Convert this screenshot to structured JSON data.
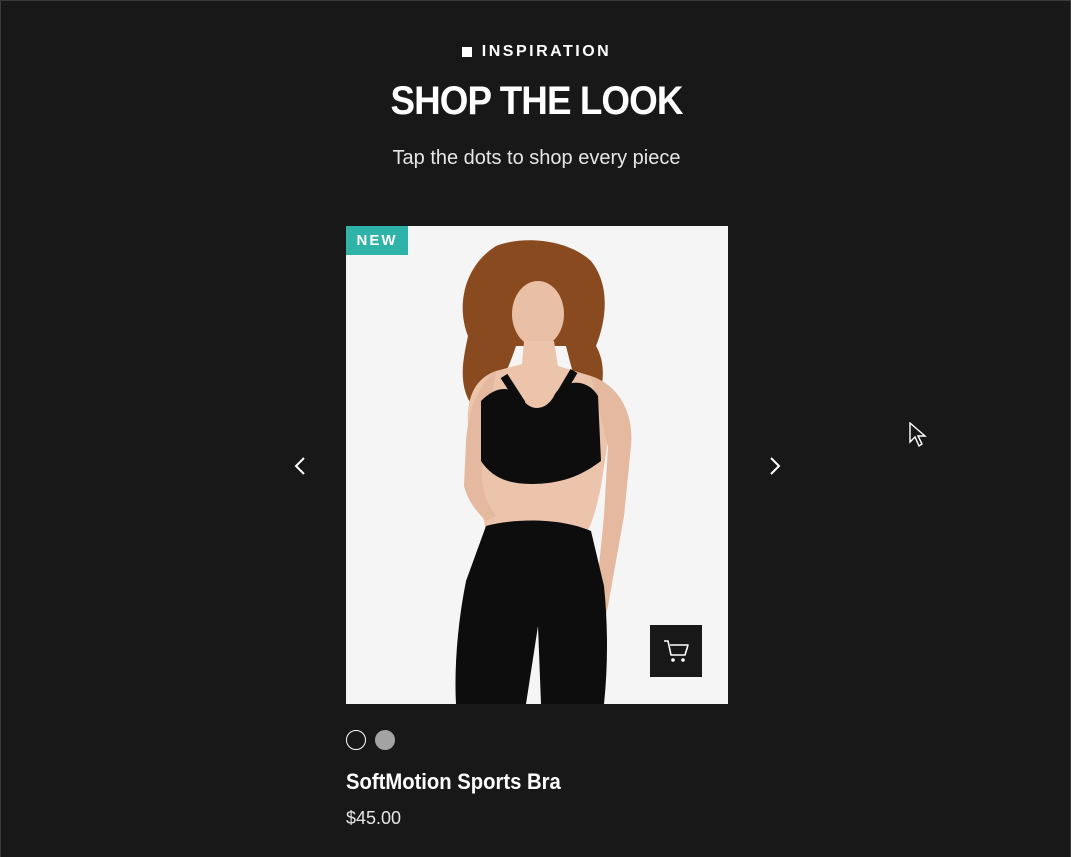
{
  "header": {
    "eyebrow": "INSPIRATION",
    "title": "SHOP THE LOOK",
    "subtitle": "Tap the dots to shop every piece"
  },
  "carousel": {
    "prev_icon": "chevron-left-icon",
    "next_icon": "chevron-right-icon"
  },
  "product": {
    "badge": "NEW",
    "name": "SoftMotion Sports Bra",
    "price": "$45.00",
    "cart_icon": "cart-icon",
    "swatches": [
      {
        "color": "#181818"
      },
      {
        "color": "#a3a3a3"
      }
    ]
  },
  "colors": {
    "background": "#181818",
    "badge": "#2fb3a8",
    "card_background": "#f5f5f5"
  }
}
